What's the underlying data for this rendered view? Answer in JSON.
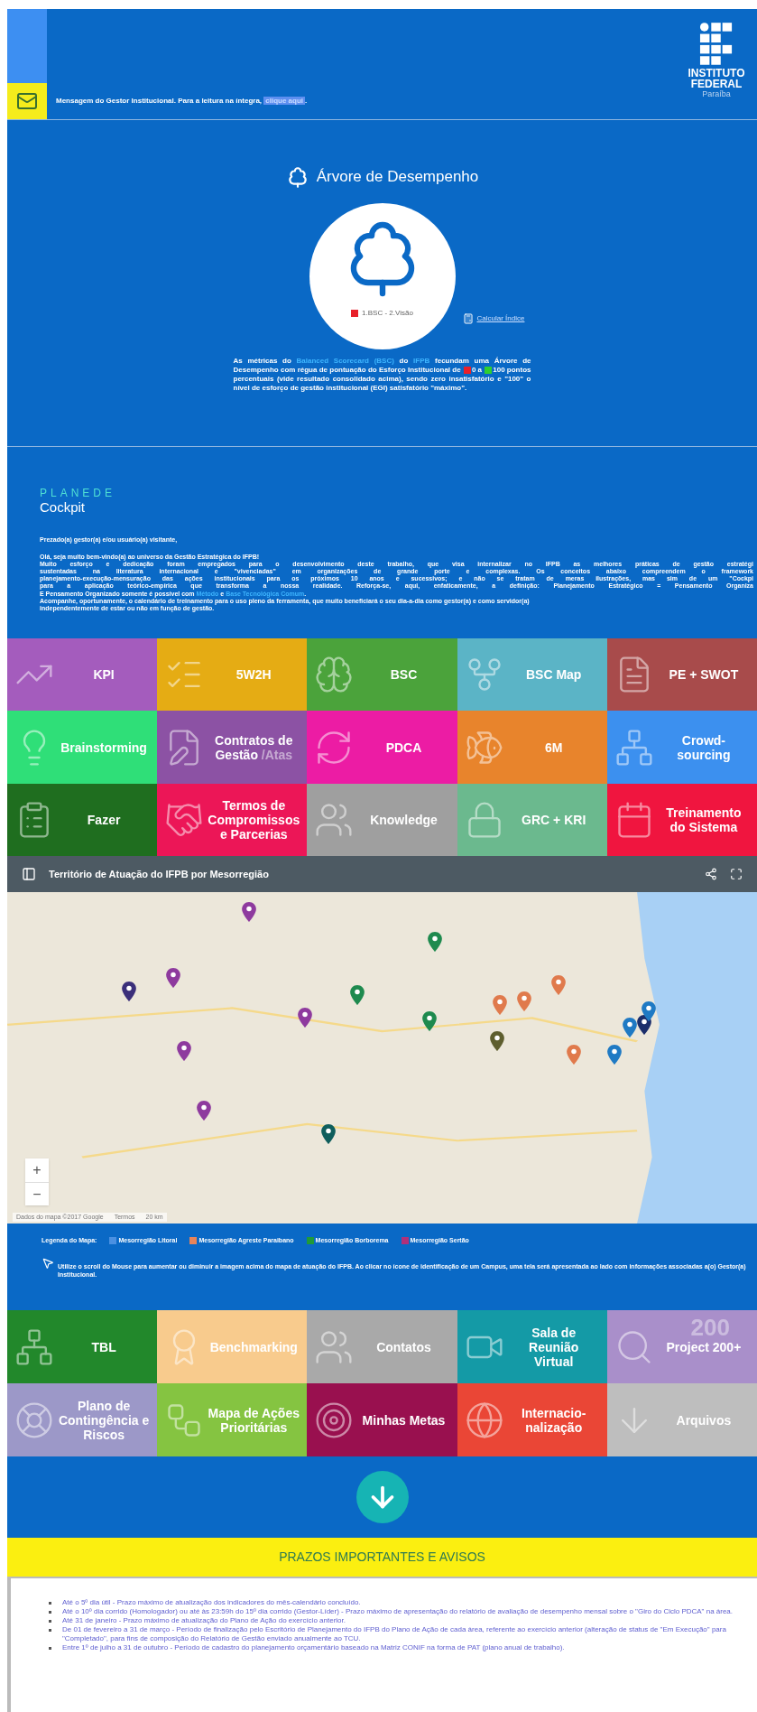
{
  "header": {
    "message": "Mensagem do Gestor Institucional. Para a leitura na íntegra, ",
    "message_link": "clique aqui",
    "message_end": ".",
    "logo": {
      "line_1": "INSTITUTO",
      "line_2": "FEDERAL",
      "line_3": "Paraíba"
    }
  },
  "performance_tree": {
    "title": "Árvore de Desempenho",
    "tree_caption": {
      "text": "1.BSC - 2.Visão",
      "color": "#e8202a"
    },
    "calc_link": "Calcular Índice",
    "description": [
      {
        "kind": "text",
        "text": "As métricas do "
      },
      {
        "kind": "link",
        "text": "Balanced Scorecard (BSC)"
      },
      {
        "kind": "text",
        "text": " do "
      },
      {
        "kind": "link",
        "text": "IFPB"
      },
      {
        "kind": "text",
        "text": " fecundam uma Árvore de Desempenho com régua de pontuação do Esforço Institucional de "
      },
      {
        "kind": "swatch",
        "color": "#e8202a"
      },
      {
        "kind": "text",
        "text": "0 a "
      },
      {
        "kind": "swatch",
        "color": "#2fcf2f"
      },
      {
        "kind": "text",
        "text": "100 pontos percentuais (vide resultado consolidado acima), sendo zero insatisfatório e \"100\" o nível de esforço de gestão institucional (EGI) satisfatório \"máximo\"."
      }
    ]
  },
  "cockpit": {
    "brand": "PLANEDE",
    "title": "Cockpit",
    "greeting": "Prezado(a) gestor(a) e/ou usuário(a) visitante,",
    "lines": [
      [
        {
          "kind": "text",
          "text": "Olá, seja muito bem-vindo(a) ao universo da Gestão Estratégica do IFPB!"
        }
      ],
      [
        {
          "kind": "text",
          "text": "Muito esforço e dedicação foram empregados para o desenvolvimento deste trabalho, que visa internalizar no IFPB as melhores práticas de gestão estratégi"
        }
      ],
      [
        {
          "kind": "text",
          "text": "sustentadas na literatura internacional e \"vivenciadas\" em organizações de grande porte e complexas. Os conceitos abaixo compreendem o framework"
        }
      ],
      [
        {
          "kind": "text",
          "text": "planejamento-execução-mensuração das ações institucionais para os próximos 10 anos e sucessivos; e não se tratam de meras ilustrações, mas sim de um \"Cockpi"
        }
      ],
      [
        {
          "kind": "text",
          "text": "para a aplicação teórico-empírica que transforma a nossa realidade. Reforça-se, aqui, enfaticamente, a definição: Planejamento Estratégico = Pensamento Organiza"
        }
      ],
      [
        {
          "kind": "text",
          "text": "E Pensamento Organizado somente é possível com "
        },
        {
          "kind": "link",
          "text": "Método"
        },
        {
          "kind": "text",
          "text": " e "
        },
        {
          "kind": "link",
          "text": "Base Tecnológica Comum"
        },
        {
          "kind": "text",
          "text": "."
        }
      ],
      [
        {
          "kind": "text",
          "text": "Acompanhe, oportunamente, o calendário de treinamento para o uso pleno da ferramenta, que muito beneficiará o seu dia-a-dia como gestor(a) e como servidor(a)"
        }
      ],
      [
        {
          "kind": "text",
          "text": "independentemente de estar ou não em função de gestão."
        }
      ]
    ]
  },
  "tiles": [
    {
      "label": "KPI",
      "color": "#a45cbd"
    },
    {
      "label": "5W2H",
      "color": "#e5ac14"
    },
    {
      "label": "BSC",
      "color": "#4ba33b"
    },
    {
      "label": "BSC Map",
      "color": "#5bb4c6"
    },
    {
      "label": "PE + SWOT",
      "color": "#a84b4b"
    },
    {
      "label": "Brainstorming",
      "color": "#2fdf78"
    },
    {
      "label": "Contratos de Gestão",
      "suffix": "/Atas",
      "color": "#8c52a4"
    },
    {
      "label": "PDCA",
      "color": "#ec1ca4"
    },
    {
      "label": "6M",
      "color": "#e8842c"
    },
    {
      "label": "Crowd-sourcing",
      "color": "#3c90ef"
    },
    {
      "label": "Fazer",
      "color": "#1f6e1f"
    },
    {
      "label": "Termos de Compromissos e Parcerias",
      "color": "#ec1657"
    },
    {
      "label": "Knowledge",
      "color": "#9f9f9f"
    },
    {
      "label": "GRC + KRI",
      "color": "#6bb98e"
    },
    {
      "label": "Treinamento do Sistema",
      "color": "#f0153f"
    }
  ],
  "map": {
    "title": "Território de Atuação do IFPB por Mesorregião",
    "zoom_in": "+",
    "zoom_out": "−",
    "attribution": "Dados do mapa ©2017 Google",
    "terms": "Termos",
    "scale": "20 km",
    "pins": [
      {
        "color": "#8e3a9e"
      },
      {
        "color": "#1e8a4e"
      },
      {
        "color": "#8e3a9e"
      },
      {
        "color": "#3b2f7a"
      },
      {
        "color": "#1e8a4e"
      },
      {
        "color": "#8e3a9e"
      },
      {
        "color": "#1e8a4e"
      },
      {
        "color": "#e07a4c"
      },
      {
        "color": "#e07a4c"
      },
      {
        "color": "#e07a4c"
      },
      {
        "color": "#5e5e2e"
      },
      {
        "color": "#e07a4c"
      },
      {
        "color": "#1f7ac4"
      },
      {
        "color": "#1f7ac4"
      },
      {
        "color": "#1b2e6b"
      },
      {
        "color": "#1f7ac4"
      },
      {
        "color": "#8e3a9e"
      },
      {
        "color": "#8e3a9e"
      },
      {
        "color": "#0f5e5c"
      }
    ]
  },
  "legend": {
    "label": "Legenda do Mapa:",
    "items": [
      {
        "text": "Mesorregião Litoral",
        "color": "#4a90e2"
      },
      {
        "text": "Mesorregião Agreste Paraibano",
        "color": "#e8845a"
      },
      {
        "text": "Mesorregião Borborema",
        "color": "#1f9a3a"
      },
      {
        "text": "Mesorregião Sertão",
        "color": "#b0307a"
      }
    ],
    "hint": "Utilize o scroll do Mouse para aumentar ou diminuir a imagem acima do mapa de atuação do IFPB. Ao clicar no ícone de identificação de um Campus, uma tela será apresentada ao lado com informações associadas a(o) Gestor(a) Institucional."
  },
  "tiles_2": [
    {
      "label": "TBL",
      "color": "#22882b"
    },
    {
      "label": "Benchmarking",
      "color": "#f8cb8d"
    },
    {
      "label": "Contatos",
      "color": "#a9a9a9"
    },
    {
      "label": "Sala de Reunião Virtual",
      "color": "#149aa6"
    },
    {
      "label": "Project 200+",
      "overlay": "200",
      "color": "#a98fca"
    },
    {
      "label": "Plano de Contingência e Riscos",
      "color": "#9c98c8"
    },
    {
      "label": "Mapa de Ações Prioritárias",
      "color": "#85c441"
    },
    {
      "label": "Minhas Metas",
      "color": "#99104f"
    },
    {
      "label": "Internacio-nalização",
      "color": "#ea4636"
    },
    {
      "label": "Arquivos",
      "color": "#bebebe"
    }
  ],
  "notices": {
    "title": "PRAZOS IMPORTANTES E AVISOS",
    "items": [
      "Até o 5º dia útil - Prazo máximo de atualização dos indicadores do mês-calendário concluído.",
      "Até o 10º dia corrido (Homologador) ou até às 23:59h do 15º dia corrido (Gestor-Líder) - Prazo máximo de apresentação do relatório de avaliação de desempenho mensal sobre o \"Giro do Ciclo PDCA\" na área.",
      "Até 31 de janeiro - Prazo máximo de atualização do Plano de Ação do exercício anterior.",
      "De 01 de fevereiro a 31 de março - Período de finalização pelo Escritório de Planejamento do IFPB do Plano de Ação de cada área, referente ao exercício anterior (alteração de status de \"Em Execução\" para \"Completado\", para fins de composição do Relatório de Gestão enviado anualmente ao TCU.",
      "Entre 1º de julho a 31 de outubro - Período de cadastro do planejamento orçamentário baseado na Matriz CONIF na forma de PAT (plano anual de trabalho)."
    ]
  }
}
